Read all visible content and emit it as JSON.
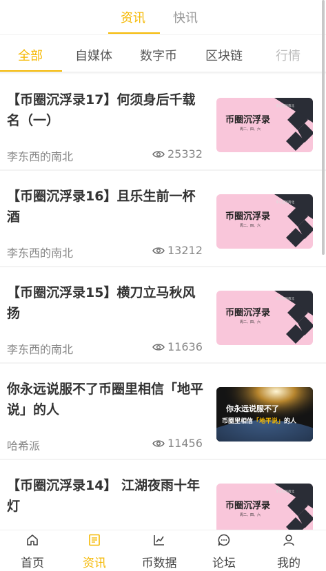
{
  "top_tabs": [
    {
      "label": "资讯",
      "active": true
    },
    {
      "label": "快讯",
      "active": false
    }
  ],
  "categories": [
    {
      "label": "全部",
      "active": true
    },
    {
      "label": "自媒体"
    },
    {
      "label": "数字币"
    },
    {
      "label": "区块链"
    },
    {
      "label": "行情"
    }
  ],
  "articles": [
    {
      "title": "【币圈沉浮录17】何须身后千载名（一）",
      "author": "李东西的南北",
      "views": "25332",
      "thumb": {
        "style": "pink",
        "heading": "币圈沉浮录",
        "sub": "周二、四、六",
        "tag": "李东西的南北"
      }
    },
    {
      "title": "【币圈沉浮录16】且乐生前一杯酒",
      "author": "李东西的南北",
      "views": "13212",
      "thumb": {
        "style": "pink",
        "heading": "币圈沉浮录",
        "sub": "周二、四、六",
        "tag": "李东西的南北"
      }
    },
    {
      "title": "【币圈沉浮录15】横刀立马秋风扬",
      "author": "李东西的南北",
      "views": "11636",
      "thumb": {
        "style": "pink",
        "heading": "币圈沉浮录",
        "sub": "周二、四、六",
        "tag": "李东西的南北"
      }
    },
    {
      "title": "你永远说服不了币圈里相信「地平说」的人",
      "author": "哈希派",
      "views": "11456",
      "thumb": {
        "style": "dark",
        "line1": "你永远说服不了",
        "line2_pre": "币圈里相信",
        "line2_hl": "「地平说」",
        "line2_post": "的人"
      }
    },
    {
      "title": "【币圈沉浮录14】  江湖夜雨十年灯",
      "author": "",
      "views": "",
      "thumb": {
        "style": "pink",
        "heading": "币圈沉浮录",
        "sub": "周二、四、六",
        "tag": "李东西的南北"
      }
    }
  ],
  "tabbar": [
    {
      "label": "首页",
      "icon": "home-icon",
      "active": false
    },
    {
      "label": "资讯",
      "icon": "news-icon",
      "active": true
    },
    {
      "label": "币数据",
      "icon": "chart-icon",
      "active": false
    },
    {
      "label": "论坛",
      "icon": "chat-icon",
      "active": false
    },
    {
      "label": "我的",
      "icon": "user-icon",
      "active": false
    }
  ],
  "colors": {
    "accent": "#f5b800",
    "thumb_pink": "#f9c6da",
    "diamond": "#2a2d36"
  }
}
